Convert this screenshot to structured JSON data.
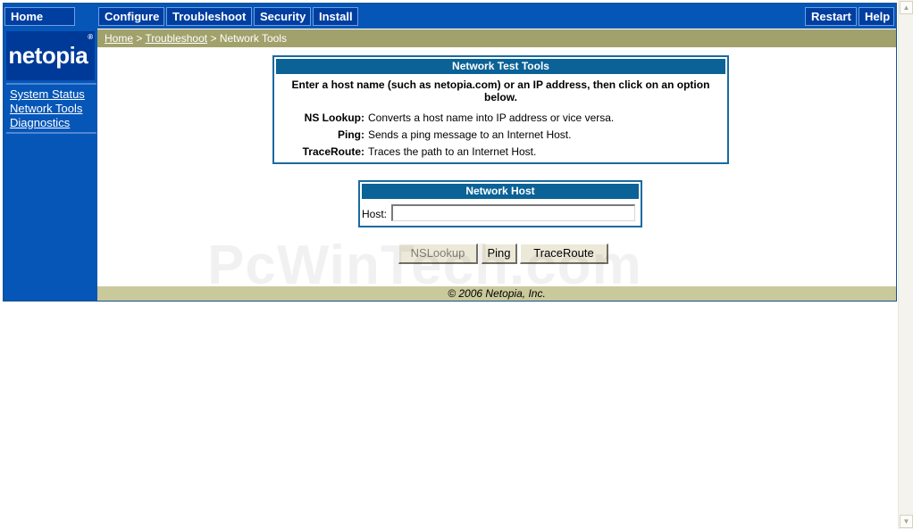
{
  "topnav": {
    "home": "Home",
    "configure": "Configure",
    "troubleshoot": "Troubleshoot",
    "security": "Security",
    "install": "Install",
    "restart": "Restart",
    "help": "Help"
  },
  "sidebar": {
    "logo": "netopia",
    "logo_mark": "®",
    "links": [
      "System Status",
      "Network Tools",
      "Diagnostics"
    ]
  },
  "breadcrumb": {
    "home": "Home",
    "sep1": ">",
    "troubleshoot": "Troubleshoot",
    "sep2": ">",
    "current": "Network Tools"
  },
  "tools_panel": {
    "title": "Network Test Tools",
    "description": "Enter a host name (such as netopia.com) or an IP address, then click on an option below.",
    "tools": [
      {
        "name": "NS Lookup:",
        "text": "Converts a host name into IP address or vice versa."
      },
      {
        "name": "Ping:",
        "text": "Sends a ping message to an Internet Host."
      },
      {
        "name": "TraceRoute:",
        "text": "Traces the path to an Internet Host."
      }
    ]
  },
  "host_panel": {
    "title": "Network Host",
    "label": "Host:",
    "value": ""
  },
  "buttons": {
    "nslookup": "NSLookup",
    "ping": "Ping",
    "traceroute": "TraceRoute"
  },
  "footer": "© 2006 Netopia, Inc.",
  "watermark": "PcWinTech.com",
  "scrollbar": {
    "up_icon": "up-arrow-icon",
    "down_icon": "down-arrow-icon"
  },
  "colors": {
    "nav_blue": "#0656b8",
    "nav_button": "#003ea0",
    "breadcrumb_bar": "#a1a16c",
    "panel_header": "#0a6296",
    "footer_bar": "#c9c99b"
  }
}
